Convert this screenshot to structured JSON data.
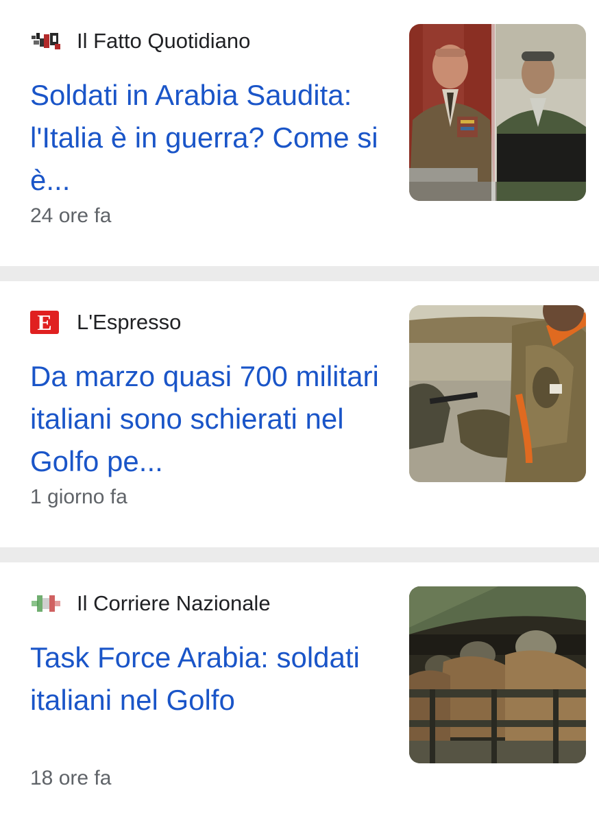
{
  "articles": [
    {
      "source": "Il Fatto Quotidiano",
      "source_logo_icon": "fatto-quotidiano-logo-icon",
      "headline": "Soldati in Arabia Saudita: l'Italia è in guerra? Come si è...",
      "time": "24 ore fa",
      "thumbnail": "two-officers-at-desk-image"
    },
    {
      "source": "L'Espresso",
      "source_logo_icon": "espresso-logo-icon",
      "source_logo_letter": "E",
      "headline": "Da marzo quasi 700 militari italiani sono schierati nel Golfo pe...",
      "time": "1 giorno fa",
      "thumbnail": "soldier-prone-in-field-image"
    },
    {
      "source": "Il Corriere Nazionale",
      "source_logo_icon": "corriere-nazionale-logo-icon",
      "headline": "Task Force Arabia: soldati italiani nel Golfo",
      "time": "18 ore fa",
      "thumbnail": "soldiers-in-truck-image"
    }
  ],
  "colors": {
    "headline": "#1a55c8",
    "source": "#202124",
    "time": "#5f6368",
    "divider": "#ebebeb"
  }
}
